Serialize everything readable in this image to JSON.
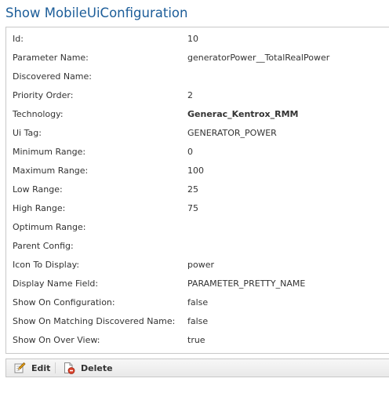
{
  "page": {
    "title": "Show MobileUiConfiguration"
  },
  "fields": [
    {
      "label": "Id:",
      "value": "10",
      "bold": false
    },
    {
      "label": "Parameter Name:",
      "value": "generatorPower__TotalRealPower",
      "bold": false
    },
    {
      "label": "Discovered Name:",
      "value": "",
      "bold": false
    },
    {
      "label": "Priority Order:",
      "value": "2",
      "bold": false
    },
    {
      "label": "Technology:",
      "value": "Generac_Kentrox_RMM",
      "bold": true
    },
    {
      "label": "Ui Tag:",
      "value": "GENERATOR_POWER",
      "bold": false
    },
    {
      "label": "Minimum Range:",
      "value": "0",
      "bold": false
    },
    {
      "label": "Maximum Range:",
      "value": "100",
      "bold": false
    },
    {
      "label": "Low Range:",
      "value": "25",
      "bold": false
    },
    {
      "label": "High Range:",
      "value": "75",
      "bold": false
    },
    {
      "label": "Optimum Range:",
      "value": "",
      "bold": false
    },
    {
      "label": "Parent Config:",
      "value": "",
      "bold": false
    },
    {
      "label": "Icon To Display:",
      "value": "power",
      "bold": false
    },
    {
      "label": "Display Name Field:",
      "value": "PARAMETER_PRETTY_NAME",
      "bold": false
    },
    {
      "label": "Show On Configuration:",
      "value": "false",
      "bold": false
    },
    {
      "label": "Show On Matching Discovered Name:",
      "value": "false",
      "bold": false
    },
    {
      "label": "Show On Over View:",
      "value": "true",
      "bold": false
    }
  ],
  "actions": {
    "edit": {
      "label": "Edit",
      "icon": "edit-pencil-icon"
    },
    "delete": {
      "label": "Delete",
      "icon": "delete-document-icon"
    }
  },
  "colors": {
    "title": "#1c5d99",
    "border": "#c8c8c8",
    "delete_accent": "#d9412b"
  }
}
